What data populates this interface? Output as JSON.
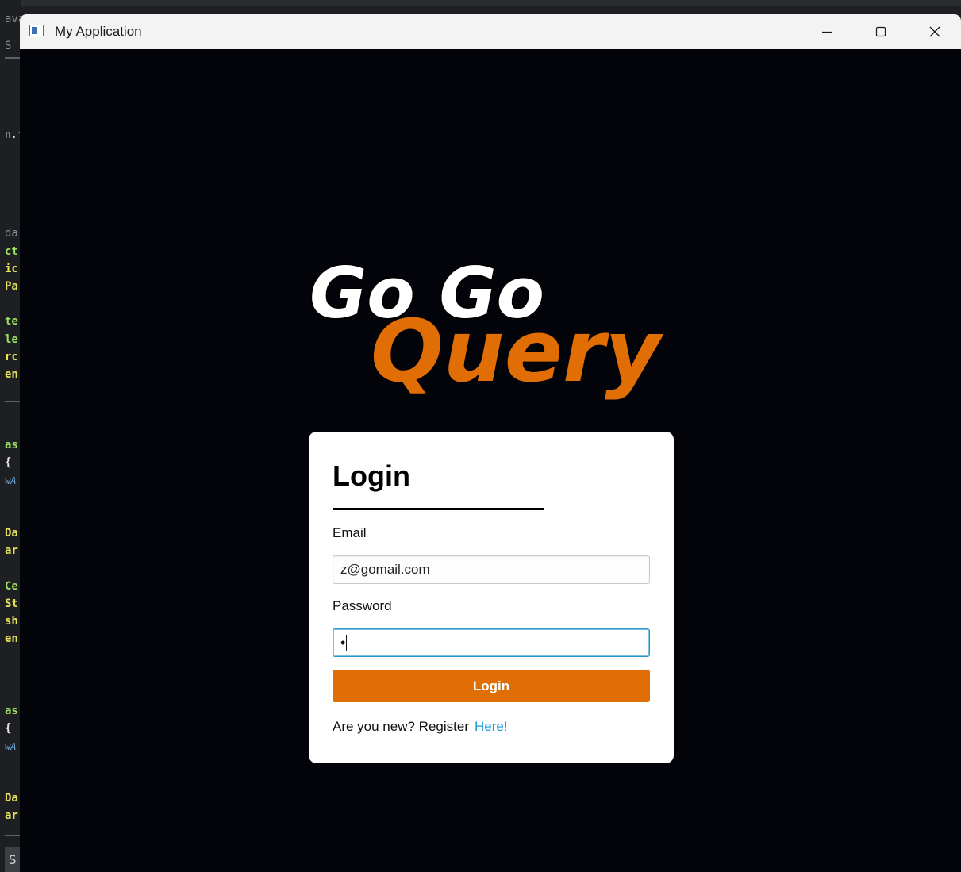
{
  "window": {
    "title": "My Application",
    "controls": {
      "minimize_icon": "minimize-icon",
      "maximize_icon": "maximize-icon",
      "close_icon": "close-icon"
    }
  },
  "logo": {
    "line1": "Go Go",
    "line2": "Query",
    "colors": {
      "line1": "#ffffff",
      "line2": "#e06e04"
    }
  },
  "login": {
    "title": "Login",
    "email_label": "Email",
    "email_value": "z@gomail.com",
    "password_label": "Password",
    "password_value": "•",
    "submit_label": "Login",
    "register_prompt": "Are you new? Register",
    "register_link": "Here!"
  },
  "colors": {
    "accent": "#e06e04",
    "link": "#1a9bd6",
    "focus": "#2a95c8",
    "background": "#03030a"
  },
  "background_editor": {
    "fragments": [
      "ava",
      "S",
      "n.ja",
      "da",
      "ct",
      "ic",
      "Pa",
      "te",
      "le",
      "rc",
      "en",
      "as",
      "{",
      "wA",
      "Da",
      "ar",
      "Ce",
      "St",
      "sh",
      "en",
      "as",
      "{",
      "wA",
      "Da",
      "ar",
      "S"
    ]
  }
}
